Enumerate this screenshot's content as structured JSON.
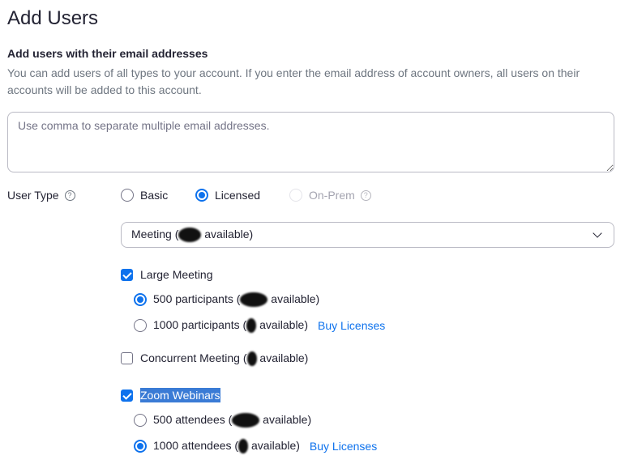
{
  "page": {
    "title": "Add Users"
  },
  "add_section": {
    "heading": "Add users with their email addresses",
    "description": "You can add users of all types to your account. If you enter the email address of account owners, all users on their accounts will be added to this account.",
    "email_placeholder": "Use comma to separate multiple email addresses.",
    "email_value": ""
  },
  "user_type": {
    "label": "User Type",
    "help": "?",
    "options": [
      {
        "label": "Basic",
        "selected": false
      },
      {
        "label": "Licensed",
        "selected": true
      },
      {
        "label": "On-Prem",
        "selected": false,
        "disabled": true
      }
    ]
  },
  "meeting_select": {
    "prefix": "Meeting (",
    "suffix": " available)"
  },
  "large_meeting": {
    "label": "Large Meeting",
    "checked": true,
    "options": [
      {
        "prefix": "500 participants (",
        "suffix": " available)",
        "selected": true
      },
      {
        "prefix": "1000 participants (",
        "suffix": " available)",
        "selected": false,
        "link": "Buy Licenses"
      }
    ]
  },
  "concurrent_meeting": {
    "prefix": "Concurrent Meeting (",
    "suffix": " available)",
    "checked": false
  },
  "zoom_webinars": {
    "label": "Zoom Webinars",
    "checked": true,
    "options": [
      {
        "prefix": "500 attendees (",
        "suffix": " available)",
        "selected": false
      },
      {
        "prefix": "1000 attendees (",
        "suffix": " available)",
        "selected": true,
        "link": "Buy Licenses"
      }
    ]
  },
  "colors": {
    "accent": "#0e72ed",
    "text": "#232333",
    "muted": "#6e7680",
    "selection_highlight": "#3a7bd5"
  }
}
